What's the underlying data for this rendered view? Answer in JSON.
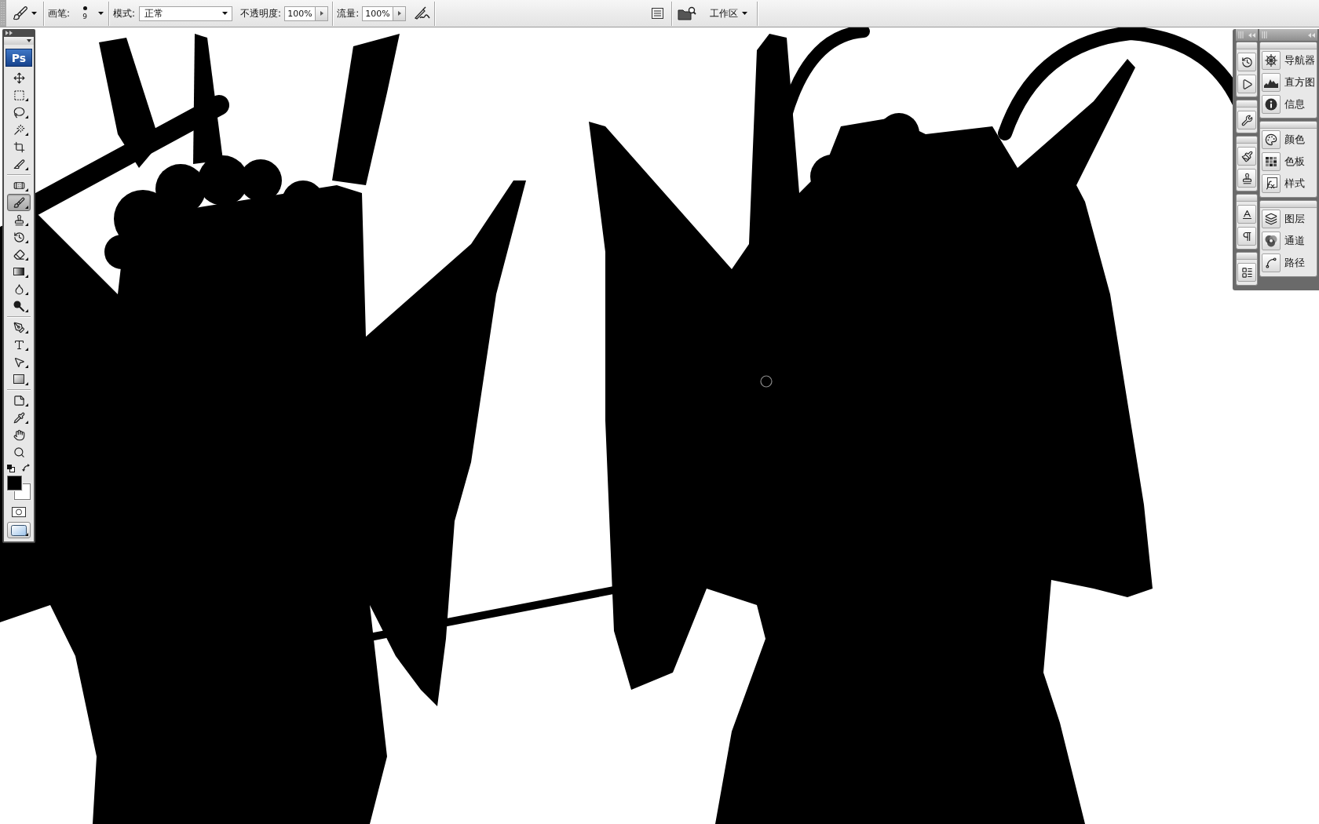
{
  "options_bar": {
    "brush_label": "画笔:",
    "brush_size": "9",
    "mode_label": "模式:",
    "mode_value": "正常",
    "opacity_label": "不透明度:",
    "opacity_value": "100%",
    "flow_label": "流量:",
    "flow_value": "100%",
    "workspace_label": "工作区"
  },
  "toolbox": {
    "logo": "Ps",
    "groups": [
      {
        "tools": [
          {
            "kind": "move",
            "selected": false,
            "flyout": false
          },
          {
            "kind": "marquee",
            "selected": false,
            "flyout": true
          },
          {
            "kind": "lasso",
            "selected": false,
            "flyout": true
          },
          {
            "kind": "wand",
            "selected": false,
            "flyout": true
          },
          {
            "kind": "crop",
            "selected": false,
            "flyout": false
          },
          {
            "kind": "slice",
            "selected": false,
            "flyout": true
          }
        ]
      },
      {
        "tools": [
          {
            "kind": "healing",
            "selected": false,
            "flyout": true
          },
          {
            "kind": "brush",
            "selected": true,
            "flyout": true
          },
          {
            "kind": "stamp",
            "selected": false,
            "flyout": true
          },
          {
            "kind": "history",
            "selected": false,
            "flyout": true
          },
          {
            "kind": "eraser",
            "selected": false,
            "flyout": true
          },
          {
            "kind": "gradient",
            "selected": false,
            "flyout": true
          },
          {
            "kind": "blur",
            "selected": false,
            "flyout": true
          },
          {
            "kind": "dodge",
            "selected": false,
            "flyout": true
          }
        ]
      },
      {
        "tools": [
          {
            "kind": "pen",
            "selected": false,
            "flyout": true
          },
          {
            "kind": "type",
            "selected": false,
            "flyout": true
          },
          {
            "kind": "path",
            "selected": false,
            "flyout": true
          },
          {
            "kind": "shape",
            "selected": false,
            "flyout": true
          }
        ]
      },
      {
        "tools": [
          {
            "kind": "notes",
            "selected": false,
            "flyout": true
          },
          {
            "kind": "eyedropper",
            "selected": false,
            "flyout": true
          },
          {
            "kind": "hand",
            "selected": false,
            "flyout": false
          },
          {
            "kind": "zoom",
            "selected": false,
            "flyout": false
          }
        ]
      }
    ],
    "colors": [
      {
        "kind": "foreground",
        "color": "#000000"
      },
      {
        "kind": "background",
        "color": "#ffffff"
      }
    ],
    "modes": [
      {
        "kind": "quickmask",
        "flyout": false
      },
      {
        "kind": "screen",
        "flyout": true
      }
    ]
  },
  "panel_dock": {
    "icon_groups": [
      {
        "buttons": [
          {
            "kind": "history"
          },
          {
            "kind": "actions"
          }
        ]
      },
      {
        "buttons": [
          {
            "kind": "presets"
          }
        ]
      },
      {
        "buttons": [
          {
            "kind": "brushes"
          },
          {
            "kind": "clone"
          }
        ]
      },
      {
        "buttons": [
          {
            "kind": "character"
          },
          {
            "kind": "paragraph"
          }
        ]
      },
      {
        "buttons": [
          {
            "kind": "comps"
          }
        ]
      }
    ],
    "panel_groups": [
      {
        "panels": [
          {
            "kind": "navigator",
            "label": "导航器"
          },
          {
            "kind": "histogram",
            "label": "直方图"
          },
          {
            "kind": "info",
            "label": "信息"
          }
        ]
      },
      {
        "panels": [
          {
            "kind": "color",
            "label": "颜色"
          },
          {
            "kind": "swatches",
            "label": "色板"
          },
          {
            "kind": "styles",
            "label": "样式"
          }
        ]
      },
      {
        "panels": [
          {
            "kind": "layers",
            "label": "图层"
          },
          {
            "kind": "channels",
            "label": "通道"
          },
          {
            "kind": "paths",
            "label": "路径"
          }
        ]
      }
    ]
  }
}
